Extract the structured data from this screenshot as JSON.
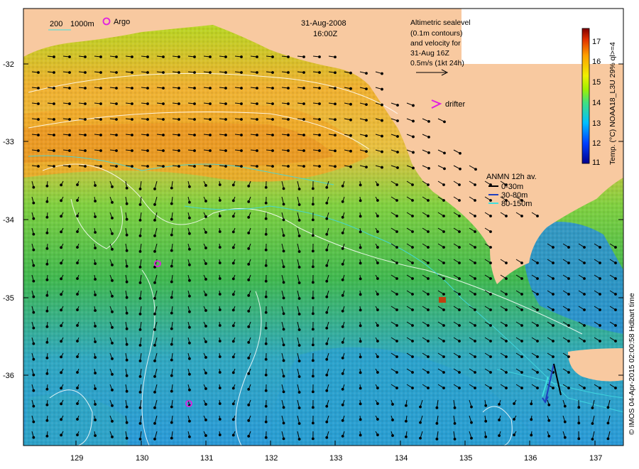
{
  "map": {
    "date": "31-Aug-2008",
    "time": "16:00Z",
    "scale_legend": {
      "label_200": "200",
      "label_1000": "1000m"
    },
    "argo_label": "Argo",
    "drifter_label": "drifter",
    "altimetry_note": [
      "Altimetric sealevel",
      "(0.1m contours)",
      "and velocity for",
      "31-Aug 16Z",
      "0.5m/s (1kt 24h)"
    ],
    "anmn": {
      "title": "ANMN 12h av.",
      "items": [
        {
          "label": "0-30m",
          "color": "#000000"
        },
        {
          "label": "30-80m",
          "color": "#1f3fbf"
        },
        {
          "label": "80-150m",
          "color": "#3fe0e0"
        }
      ]
    },
    "colorbar": {
      "title": "Temp. (°C) NOAA18_L3U 29% ql>=4",
      "ticks": [
        "11",
        "12",
        "13",
        "14",
        "15",
        "16",
        "17"
      ]
    },
    "x_ticks": [
      "129",
      "130",
      "131",
      "132",
      "133",
      "134",
      "135",
      "136",
      "137"
    ],
    "y_ticks": [
      "-32",
      "-33",
      "-34",
      "-35",
      "-36"
    ],
    "credit": "© IMOS 04-Apr-2015 02:00:58 Hdbart time",
    "colors": {
      "land": "#f8c9a0",
      "warm": "#f0a020",
      "cool": "#2aa7d8"
    }
  }
}
